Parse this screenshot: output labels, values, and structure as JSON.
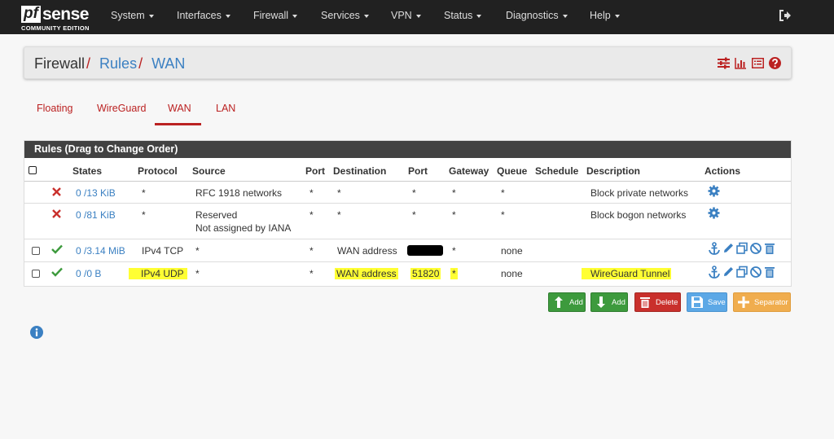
{
  "brand": {
    "logo_pf": "pf",
    "logo_sense": "sense",
    "logo_edition": "COMMUNITY EDITION"
  },
  "nav": {
    "items": [
      {
        "label": "System"
      },
      {
        "label": "Interfaces"
      },
      {
        "label": "Firewall"
      },
      {
        "label": "Services"
      },
      {
        "label": "VPN"
      },
      {
        "label": "Status"
      },
      {
        "label": "Diagnostics"
      },
      {
        "label": "Help"
      }
    ]
  },
  "breadcrumb": {
    "root": "Firewall",
    "section": "Rules",
    "page": "WAN",
    "sep": "/"
  },
  "tabs": [
    {
      "label": "Floating"
    },
    {
      "label": "WireGuard"
    },
    {
      "label": "WAN",
      "active": true
    },
    {
      "label": "LAN"
    }
  ],
  "rules": {
    "heading": "Rules (Drag to Change Order)",
    "columns": [
      "States",
      "Protocol",
      "Source",
      "Port",
      "Destination",
      "Port",
      "Gateway",
      "Queue",
      "Schedule",
      "Description",
      "Actions"
    ],
    "rows": [
      {
        "status": "block",
        "states": "0 /13 KiB",
        "protocol": "*",
        "source": "RFC 1918 networks",
        "src_port": "*",
        "destination": "*",
        "dst_port": "*",
        "gateway": "*",
        "queue": "*",
        "schedule": "",
        "description": "Block private networks"
      },
      {
        "status": "block",
        "states": "0 /81 KiB",
        "protocol": "*",
        "source": "Reserved",
        "source_note": "Not assigned by IANA",
        "src_port": "*",
        "destination": "*",
        "dst_port": "*",
        "gateway": "*",
        "queue": "*",
        "schedule": "",
        "description": "Block bogon networks"
      },
      {
        "status": "pass",
        "states": "0 /3.14 MiB",
        "protocol": "IPv4 TCP",
        "source": "*",
        "src_port": "*",
        "destination": "WAN address",
        "dst_port": "",
        "gateway": "*",
        "queue": "none",
        "schedule": "",
        "description": ""
      },
      {
        "status": "pass",
        "states": "0 /0 B",
        "protocol": "IPv4 UDP",
        "source": "*",
        "src_port": "*",
        "destination": "WAN address",
        "dst_port": "51820",
        "gateway": "*",
        "queue": "none",
        "schedule": "",
        "description": "WireGuard Tunnel"
      }
    ]
  },
  "buttons": {
    "add_top": "Add",
    "add_bottom": "Add",
    "delete": "Delete",
    "save": "Save",
    "separator": "Separator"
  },
  "colors": {
    "navbar": "#212121",
    "accent_red": "#b22222",
    "link_blue": "#3b80c2",
    "highlight": "#ffff33",
    "pass_green": "#3d9a3d",
    "block_red": "#c9302c"
  }
}
